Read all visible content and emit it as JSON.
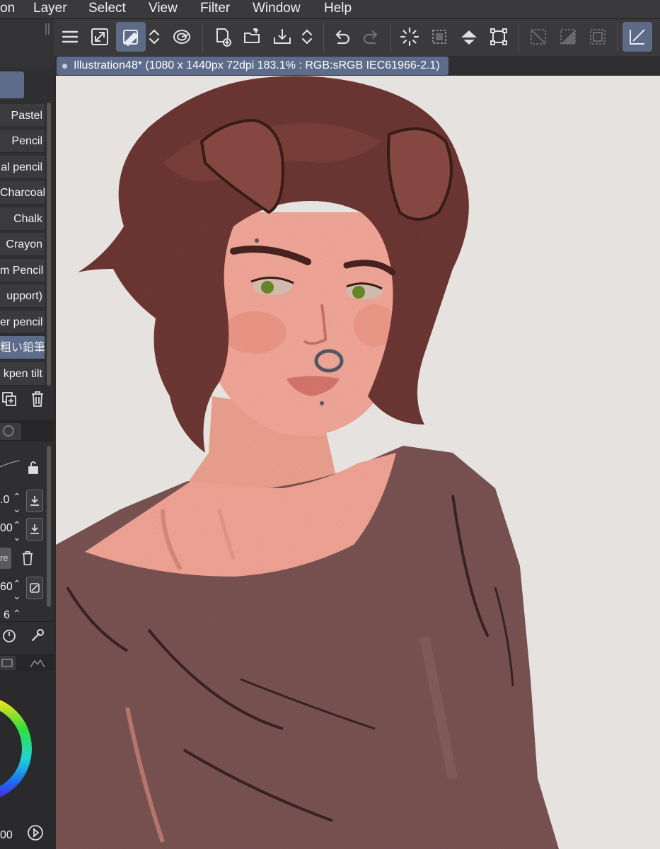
{
  "menubar": {
    "items": [
      "on",
      "Layer",
      "Select",
      "View",
      "Filter",
      "Window",
      "Help"
    ]
  },
  "command_bar": {
    "icons": [
      "menu-icon",
      "fit-canvas-icon",
      "brush-size-icon",
      "up-down-icon",
      "spiral-icon",
      "new-file-icon",
      "open-folder-icon",
      "export-icon",
      "up-down-icon",
      "undo-icon",
      "redo-icon",
      "loading-spinner-icon",
      "selection-icon",
      "fill-icon",
      "transform-icon",
      "deselect-icon",
      "invert-selection-icon",
      "selection-frame-icon",
      "snap-icon"
    ],
    "active_color": "#5e6b86"
  },
  "canvas_tab": {
    "title": "Illustration48* (1080 x 1440px 72dpi 183.1% : RGB:sRGB IEC61966-2.1)"
  },
  "brush_list": {
    "items": [
      "Pastel",
      "Pencil",
      "al pencil",
      "Charcoal",
      "Chalk",
      "Crayon",
      "m Pencil",
      "upport)",
      "er pencil",
      "粗い鉛筆",
      "kpen tilt"
    ],
    "selected_index": 9
  },
  "tool_properties": {
    "rows": [
      {
        "value": ".0"
      },
      {
        "value": "00"
      },
      {
        "value": "re"
      },
      {
        "value": "60"
      },
      {
        "value": "6"
      }
    ]
  },
  "color_wheel": {
    "value": "00"
  },
  "colors": {
    "menubar": "#3a3a3c",
    "accent": "#5d6c8b",
    "canvas_bg": "#e6e2df",
    "hair": "#6b3732",
    "skin": "#f4a898",
    "shirt": "#7a5454"
  }
}
